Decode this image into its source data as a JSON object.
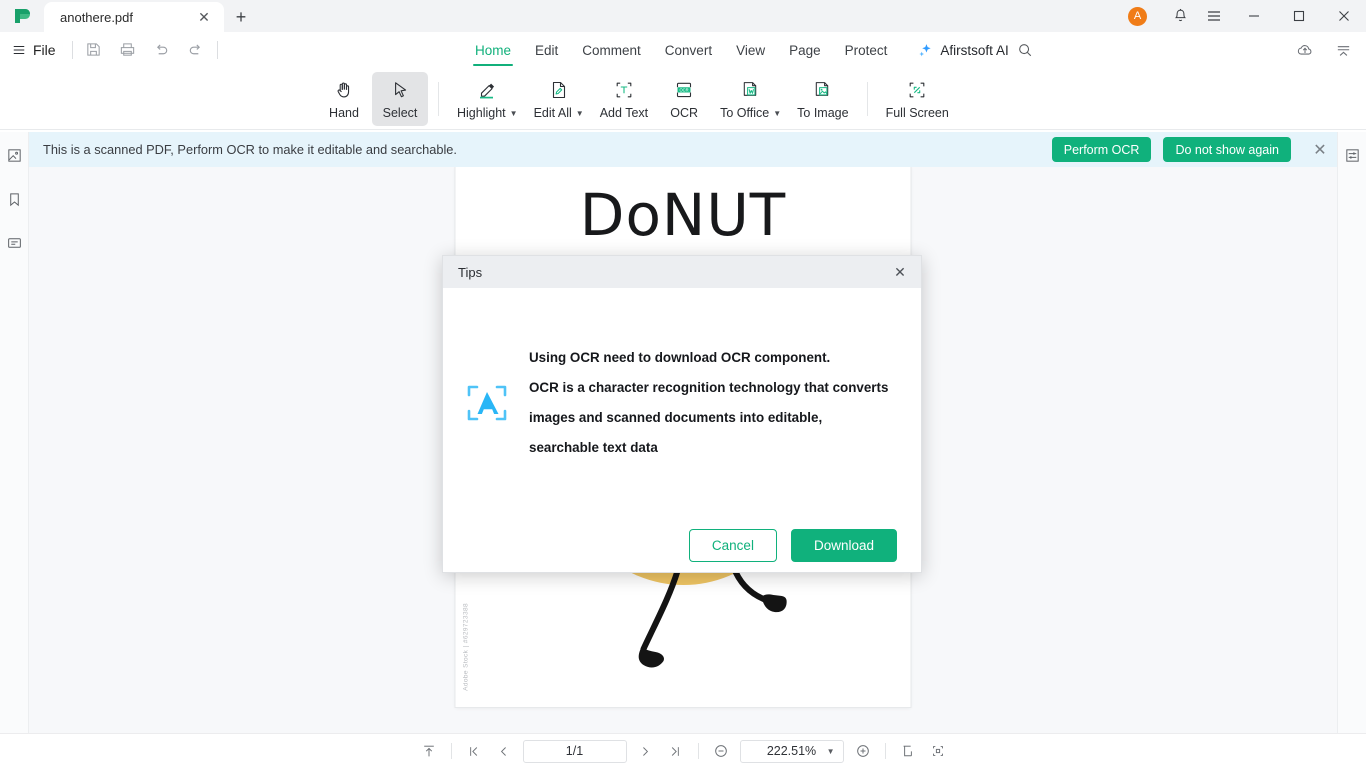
{
  "window": {
    "tab_title": "anothere.pdf",
    "new_tab_label": "+",
    "avatar_letter": "A",
    "minimize_label": "—",
    "maximize_label": "□",
    "close_label": "✕"
  },
  "menu": {
    "file_label": "File",
    "tabs": [
      {
        "label": "Home",
        "active": true
      },
      {
        "label": "Edit",
        "active": false
      },
      {
        "label": "Comment",
        "active": false
      },
      {
        "label": "Convert",
        "active": false
      },
      {
        "label": "View",
        "active": false
      },
      {
        "label": "Page",
        "active": false
      },
      {
        "label": "Protect",
        "active": false
      }
    ],
    "ai_label": "Afirstsoft AI"
  },
  "toolbar": {
    "items": [
      {
        "label": "Hand",
        "icon": "hand-icon",
        "caret": false,
        "selected": false
      },
      {
        "label": "Select",
        "icon": "cursor-icon",
        "caret": false,
        "selected": true
      },
      {
        "label": "Highlight",
        "icon": "highlighter-icon",
        "caret": true,
        "selected": false
      },
      {
        "label": "Edit All",
        "icon": "edit-page-icon",
        "caret": true,
        "selected": false
      },
      {
        "label": "Add Text",
        "icon": "add-text-icon",
        "caret": false,
        "selected": false
      },
      {
        "label": "OCR",
        "icon": "ocr-icon",
        "caret": false,
        "selected": false
      },
      {
        "label": "To Office",
        "icon": "to-office-icon",
        "caret": true,
        "selected": false
      },
      {
        "label": "To Image",
        "icon": "to-image-icon",
        "caret": false,
        "selected": false
      },
      {
        "label": "Full Screen",
        "icon": "full-screen-icon",
        "caret": false,
        "selected": false
      }
    ]
  },
  "notice": {
    "message": "This is a scanned PDF, Perform OCR to make it editable and searchable.",
    "primary_label": "Perform OCR",
    "secondary_label": "Do not show again",
    "close_label": "✕"
  },
  "document": {
    "title_text": "DoNUT",
    "watermark": "Adobe Stock | #629723388"
  },
  "status": {
    "page_value": "1/1",
    "zoom_value": "222.51%",
    "zoom_caret": "▼"
  },
  "modal": {
    "title": "Tips",
    "close_label": "✕",
    "lines": [
      "Using OCR need to download OCR component.",
      "OCR is a character recognition technology that converts",
      "images and scanned documents into editable,",
      "searchable text data"
    ],
    "cancel_label": "Cancel",
    "download_label": "Download"
  },
  "colors": {
    "accent_green": "#10b17c",
    "notice_bg": "#e6f4fb",
    "avatar_orange": "#f07c17"
  }
}
